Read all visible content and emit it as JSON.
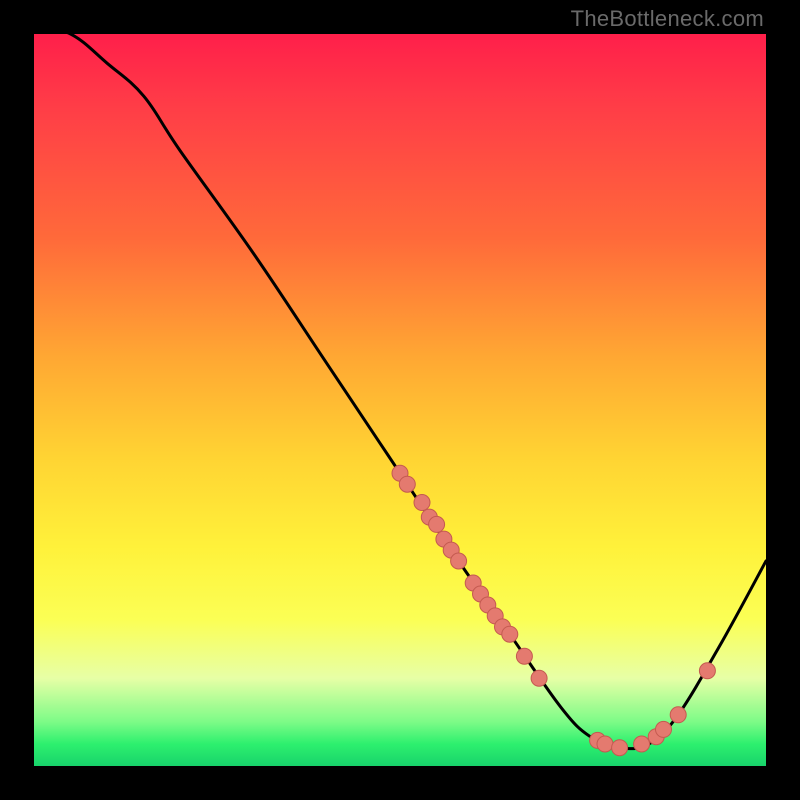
{
  "watermark": "TheBottleneck.com",
  "chart_data": {
    "type": "line",
    "title": "",
    "xlabel": "",
    "ylabel": "",
    "xlim": [
      0,
      100
    ],
    "ylim": [
      0,
      100
    ],
    "curve": [
      {
        "x": 0,
        "y": 101
      },
      {
        "x": 5,
        "y": 100
      },
      {
        "x": 10,
        "y": 96
      },
      {
        "x": 15,
        "y": 91.5
      },
      {
        "x": 20,
        "y": 84
      },
      {
        "x": 30,
        "y": 70
      },
      {
        "x": 40,
        "y": 55
      },
      {
        "x": 50,
        "y": 40
      },
      {
        "x": 58,
        "y": 28
      },
      {
        "x": 65,
        "y": 18
      },
      {
        "x": 72,
        "y": 8
      },
      {
        "x": 76,
        "y": 4
      },
      {
        "x": 80,
        "y": 2.5
      },
      {
        "x": 84,
        "y": 3
      },
      {
        "x": 88,
        "y": 7
      },
      {
        "x": 94,
        "y": 17
      },
      {
        "x": 100,
        "y": 28
      }
    ],
    "points": [
      {
        "x": 50,
        "y": 40
      },
      {
        "x": 51,
        "y": 38.5
      },
      {
        "x": 53,
        "y": 36
      },
      {
        "x": 54,
        "y": 34
      },
      {
        "x": 55,
        "y": 33
      },
      {
        "x": 56,
        "y": 31
      },
      {
        "x": 57,
        "y": 29.5
      },
      {
        "x": 58,
        "y": 28
      },
      {
        "x": 60,
        "y": 25
      },
      {
        "x": 61,
        "y": 23.5
      },
      {
        "x": 62,
        "y": 22
      },
      {
        "x": 63,
        "y": 20.5
      },
      {
        "x": 64,
        "y": 19
      },
      {
        "x": 65,
        "y": 18
      },
      {
        "x": 67,
        "y": 15
      },
      {
        "x": 69,
        "y": 12
      },
      {
        "x": 77,
        "y": 3.5
      },
      {
        "x": 78,
        "y": 3
      },
      {
        "x": 80,
        "y": 2.5
      },
      {
        "x": 83,
        "y": 3
      },
      {
        "x": 85,
        "y": 4
      },
      {
        "x": 86,
        "y": 5
      },
      {
        "x": 88,
        "y": 7
      },
      {
        "x": 92,
        "y": 13
      }
    ],
    "colors": {
      "curve": "#000000",
      "point_fill": "#e47a6f",
      "point_stroke": "#c45a50"
    }
  }
}
